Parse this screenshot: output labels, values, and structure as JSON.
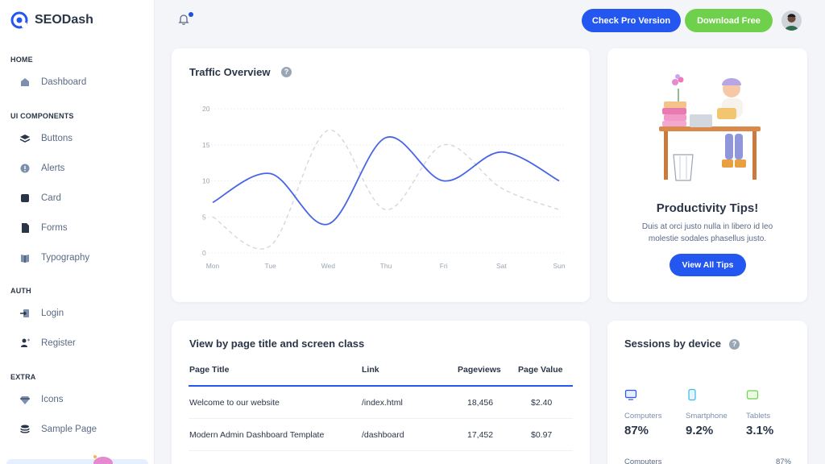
{
  "brand": {
    "name": "SEODash",
    "accent": "#2456f0"
  },
  "sidebar": {
    "sections": [
      {
        "label": "HOME",
        "items": [
          {
            "label": "Dashboard",
            "icon": "dashboard-icon"
          }
        ]
      },
      {
        "label": "UI COMPONENTS",
        "items": [
          {
            "label": "Buttons",
            "icon": "layers-icon"
          },
          {
            "label": "Alerts",
            "icon": "alert-icon"
          },
          {
            "label": "Card",
            "icon": "card-icon"
          },
          {
            "label": "Forms",
            "icon": "file-icon"
          },
          {
            "label": "Typography",
            "icon": "book-icon"
          }
        ]
      },
      {
        "label": "AUTH",
        "items": [
          {
            "label": "Login",
            "icon": "login-icon"
          },
          {
            "label": "Register",
            "icon": "user-add-icon"
          }
        ]
      },
      {
        "label": "EXTRA",
        "items": [
          {
            "label": "Icons",
            "icon": "gem-icon"
          },
          {
            "label": "Sample Page",
            "icon": "stack-icon"
          }
        ]
      }
    ]
  },
  "topbar": {
    "check_pro": "Check Pro Version",
    "download_free": "Download Free",
    "pro_color": "#2456f0",
    "free_color": "#6fd14b"
  },
  "traffic": {
    "title": "Traffic Overview",
    "help": "?"
  },
  "chart_data": {
    "type": "line",
    "categories": [
      "Mon",
      "Tue",
      "Wed",
      "Thu",
      "Fri",
      "Sat",
      "Sun"
    ],
    "yticks": [
      0,
      5,
      10,
      15,
      20
    ],
    "ylim": [
      0,
      20
    ],
    "series": [
      {
        "values": [
          7,
          11,
          4,
          16,
          10,
          14,
          10
        ],
        "color": "#4765e6",
        "style": "solid"
      },
      {
        "values": [
          5,
          1,
          17,
          6,
          15,
          9,
          6
        ],
        "color": "#d3d7de",
        "style": "dashed"
      }
    ],
    "grid": true
  },
  "tips": {
    "title": "Productivity Tips!",
    "text": "Duis at orci justo nulla in libero id leo molestie sodales phasellus justo.",
    "button": "View All Tips"
  },
  "table": {
    "title": "View by page title and screen class",
    "headers": [
      "Page Title",
      "Link",
      "Pageviews",
      "Page Value"
    ],
    "rows": [
      {
        "title": "Welcome to our website",
        "link": "/index.html",
        "views": "18,456",
        "value": "$2.40"
      },
      {
        "title": "Modern Admin Dashboard Template",
        "link": "/dashboard",
        "views": "17,452",
        "value": "$0.97"
      }
    ]
  },
  "sessions": {
    "title": "Sessions by device",
    "help": "?",
    "devices": [
      {
        "label": "Computers",
        "value": "87%",
        "icon": "monitor-icon",
        "color": "#2456f0"
      },
      {
        "label": "Smartphone",
        "value": "9.2%",
        "icon": "phone-icon",
        "color": "#3bb8e8"
      },
      {
        "label": "Tablets",
        "value": "3.1%",
        "icon": "tablet-icon",
        "color": "#6fd14b"
      }
    ],
    "bar": {
      "label": "Computers",
      "value": "87%"
    }
  }
}
